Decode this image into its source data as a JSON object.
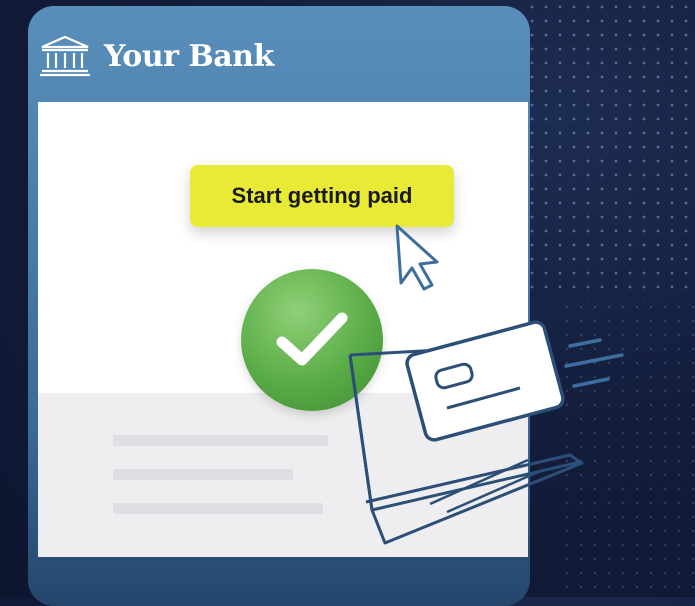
{
  "brand": {
    "name": "Your Bank",
    "icon": "bank-building-icon"
  },
  "cta": {
    "label": "Start getting paid"
  },
  "icons": {
    "cursor": "cursor-icon",
    "check": "checkmark-icon",
    "card": "credit-card-icon",
    "laptop": "laptop-icon"
  },
  "colors": {
    "background": "#131e3c",
    "card": "#4a7ea9",
    "cta": "#e8ea36",
    "success": "#5aac47",
    "outline": "#2c4f78"
  }
}
